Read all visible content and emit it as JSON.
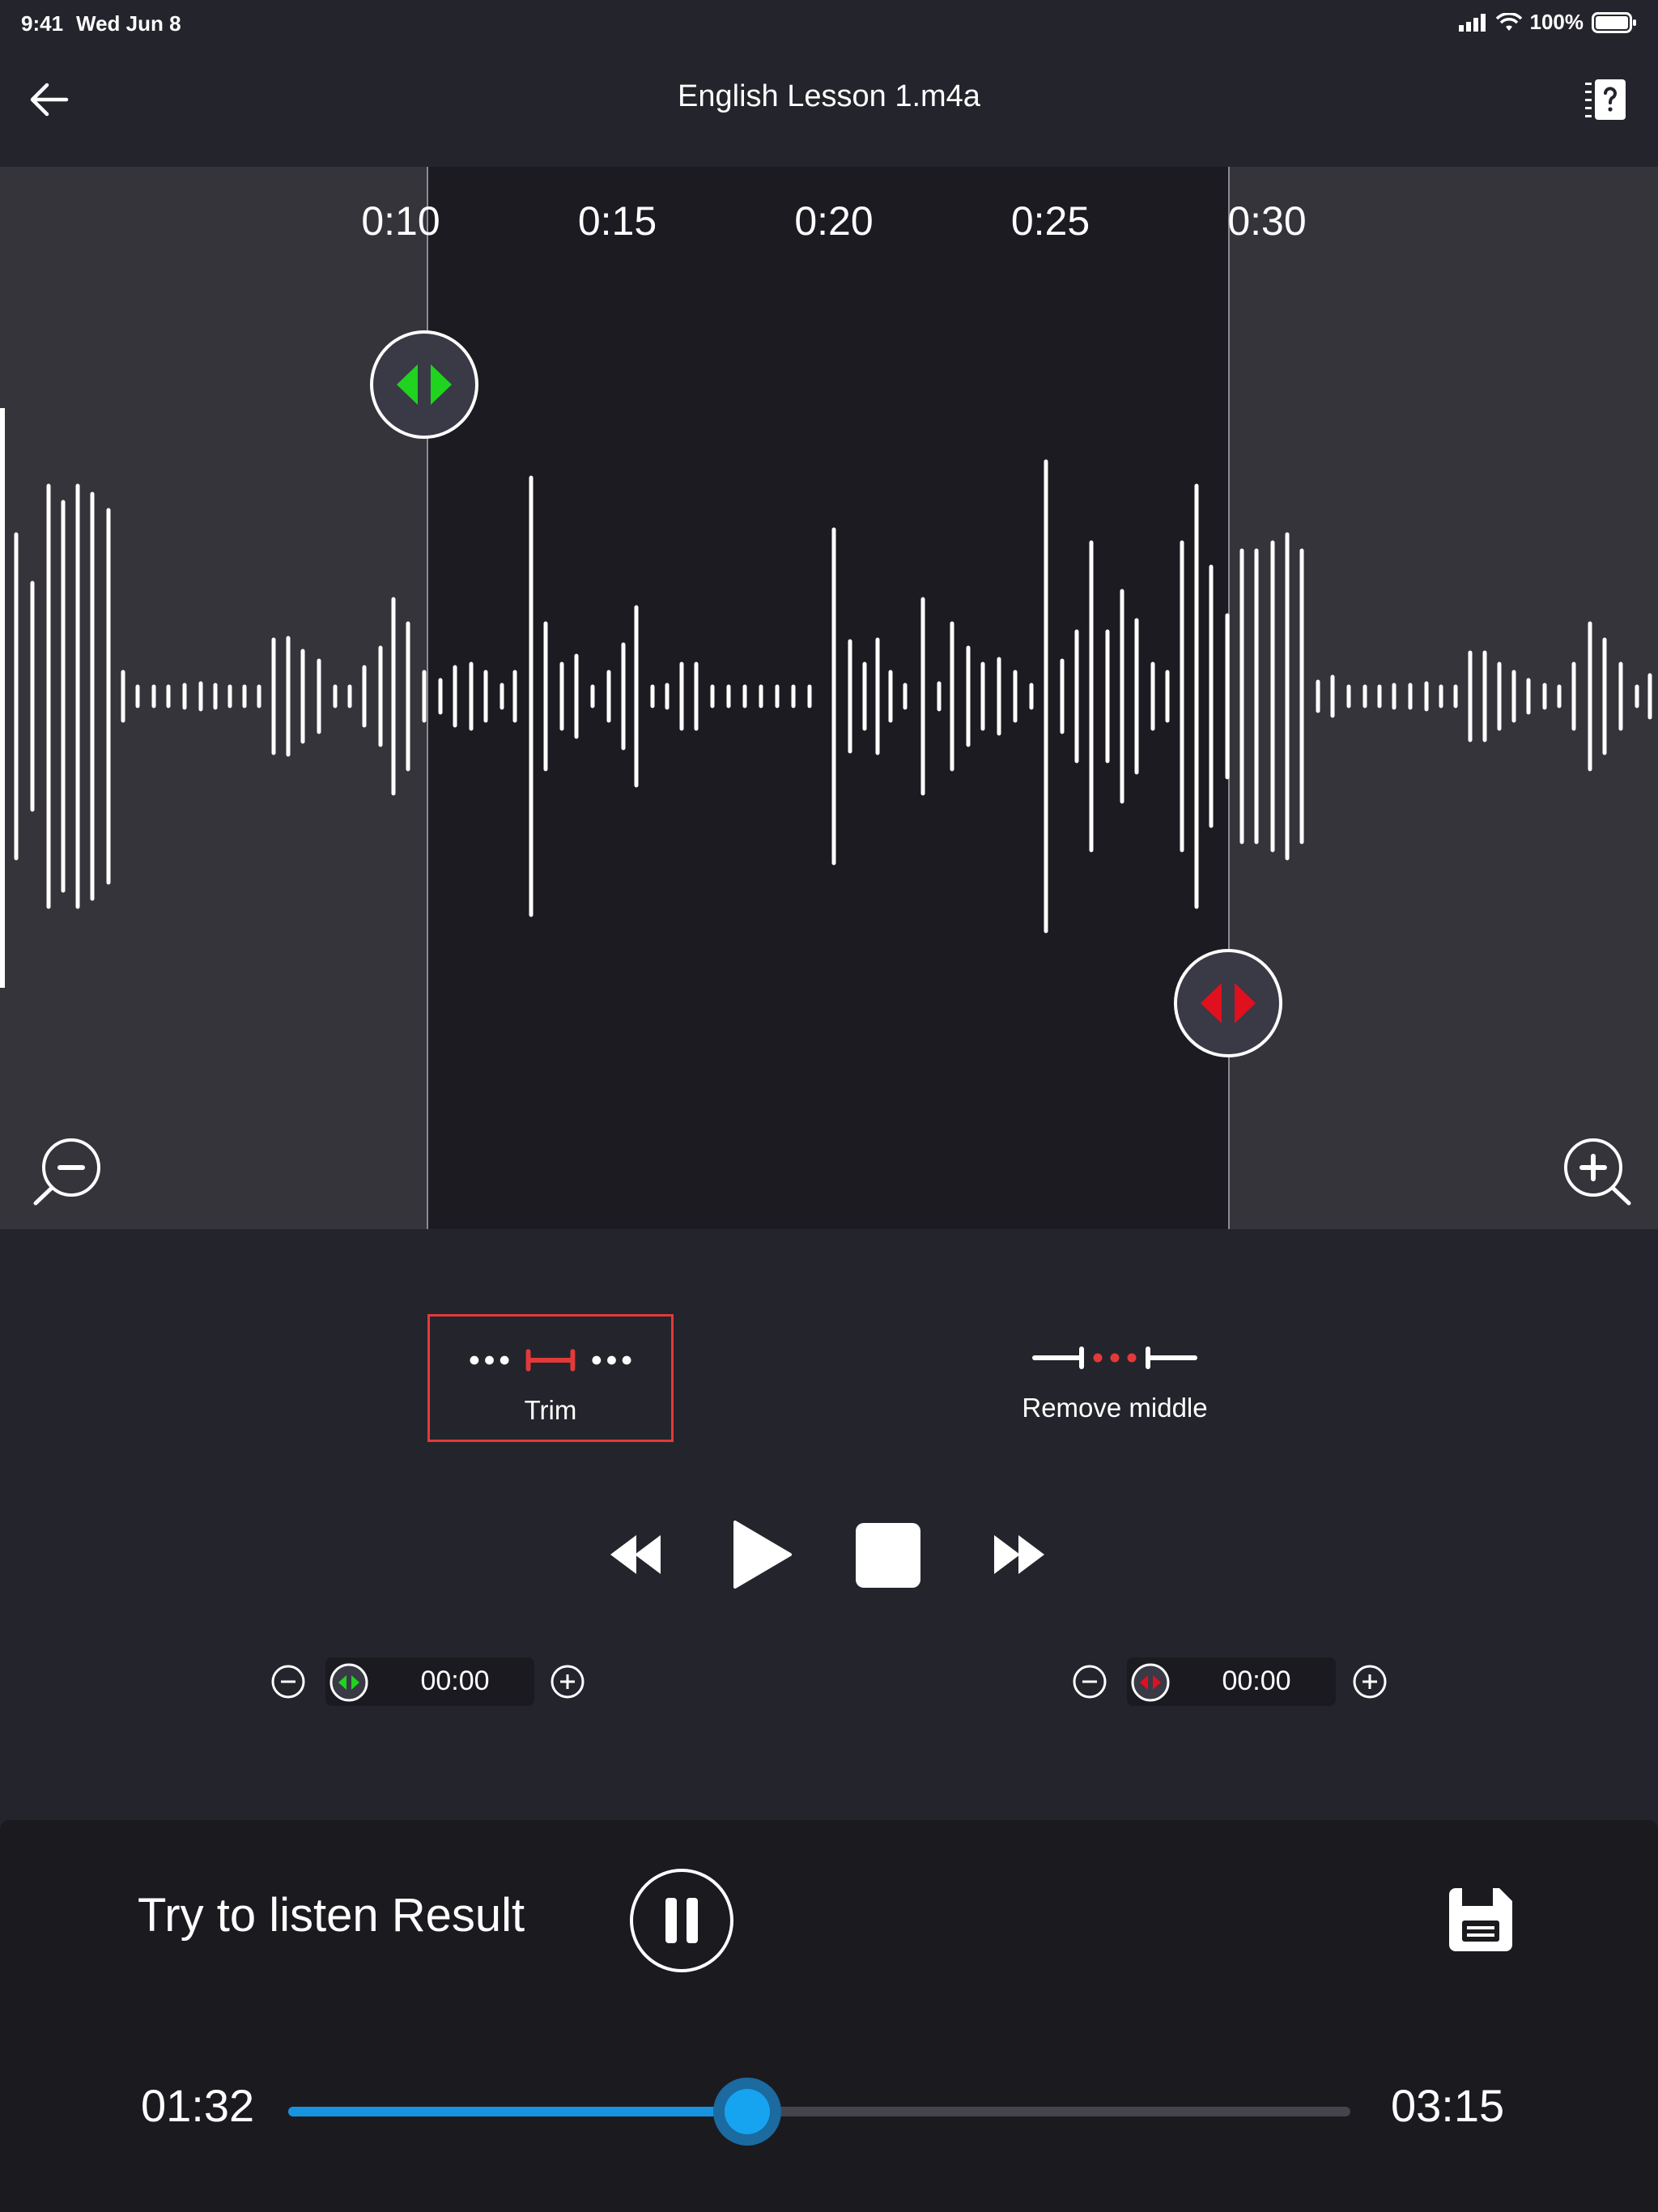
{
  "status_bar": {
    "time": "9:41",
    "date": "Wed Jun 8",
    "battery": "100%"
  },
  "nav": {
    "title": "English Lesson 1.m4a"
  },
  "editor": {
    "timeline_ticks": [
      {
        "label": "0:10",
        "seconds": 10
      },
      {
        "label": "0:15",
        "seconds": 15
      },
      {
        "label": "0:20",
        "seconds": 20
      },
      {
        "label": "0:25",
        "seconds": 25
      },
      {
        "label": "0:30",
        "seconds": 30
      }
    ],
    "selection_start_seconds": 10.6,
    "selection_end_seconds": 29.4,
    "colors": {
      "start_handle": "#1fd31f",
      "end_handle": "#e0101e",
      "selection_bg": "#1c1b21",
      "outside_bg": "#35343b"
    }
  },
  "modes": {
    "trim": {
      "label": "Trim",
      "selected": true
    },
    "remove_middle": {
      "label": "Remove middle",
      "selected": false
    }
  },
  "steppers": {
    "start": {
      "value": "00:00"
    },
    "end": {
      "value": "00:00"
    }
  },
  "result": {
    "label": "Try to listen Result",
    "elapsed": "01:32",
    "total": "03:15",
    "progress": 0.432,
    "accent": "#1793e0"
  }
}
